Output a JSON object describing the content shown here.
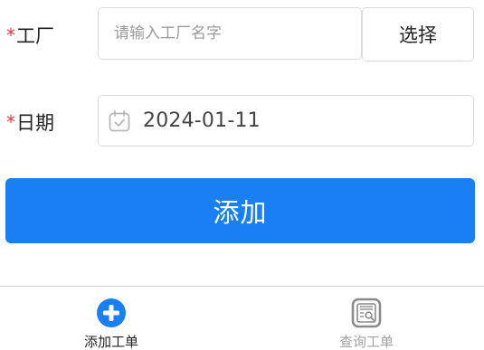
{
  "form": {
    "factory": {
      "required_mark": "*",
      "label": "工厂",
      "placeholder": "请输入工厂名字",
      "value": "",
      "select_label": "选择"
    },
    "date": {
      "required_mark": "*",
      "label": "日期",
      "value": "2024-01-11",
      "icon": "calendar-icon"
    },
    "submit_label": "添加"
  },
  "tabbar": {
    "items": [
      {
        "label": "添加工单",
        "icon": "add-circle-icon",
        "active": true
      },
      {
        "label": "查询工单",
        "icon": "search-document-icon",
        "active": false
      }
    ]
  },
  "colors": {
    "primary": "#1a7ff5",
    "required": "#e0383e",
    "inactive_tab": "#a3a3a3",
    "border": "#dcdcdc"
  }
}
